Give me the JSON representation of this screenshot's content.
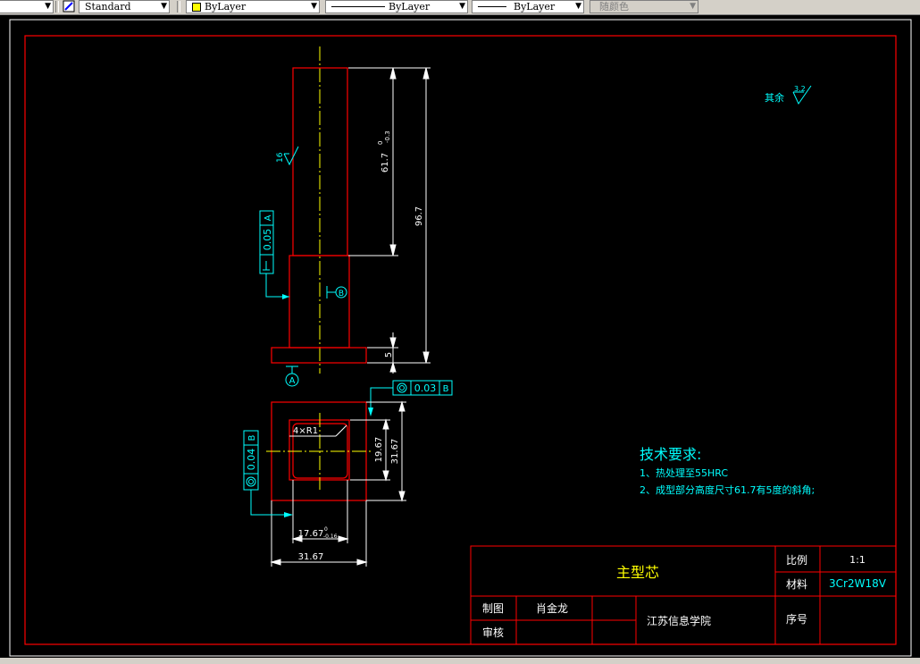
{
  "toolbar": {
    "text_style": "Standard",
    "layer": "ByLayer",
    "linetype": "ByLayer",
    "lineweight": "ByLayer",
    "plot_style": "随颜色"
  },
  "drawing": {
    "roughness_default": "其余",
    "roughness_default_value": "3.2",
    "roughness_face": "16",
    "dim_upper_height": "61.7",
    "dim_upper_tol_upper": "0",
    "dim_upper_tol_lower": "-0.3",
    "dim_total_height": "96.7",
    "dim_flange": "5",
    "perp_tol_value": "0.05",
    "perp_tol_datum": "A",
    "datum_b": "B",
    "datum_a": "A",
    "conc_tol_value": "0.03",
    "conc_tol_datum": "B",
    "fillet_label": "4×R1",
    "dim_inner_height": "19.67",
    "dim_outer_height": "31.67",
    "conc_tol_value_2": "0.04",
    "conc_tol_datum_2": "B",
    "dim_inner_width": "17.67",
    "dim_inner_width_tol_upper": "0",
    "dim_inner_width_tol_lower": "-0.16",
    "dim_outer_width": "31.67"
  },
  "tech_requirements": {
    "title": "技术要求:",
    "items": [
      "1、热处理至55HRC",
      "2、成型部分高度尺寸61.7有5度的斜角;"
    ]
  },
  "title_block": {
    "part_name": "主型芯",
    "scale_label": "比例",
    "scale_value": "1:1",
    "material_label": "材料",
    "material_value": "3Cr2W18V",
    "drawn_label": "制图",
    "drawn_name": "肖金龙",
    "checked_label": "审核",
    "institution": "江苏信息学院",
    "serial_label": "序号"
  },
  "colors": {
    "border": "#ff0000",
    "part_outline": "#ff0000",
    "centerline": "#ffff00",
    "dimension": "#ffffff",
    "annotation": "#00ffff",
    "title_text": "#ffff00"
  }
}
